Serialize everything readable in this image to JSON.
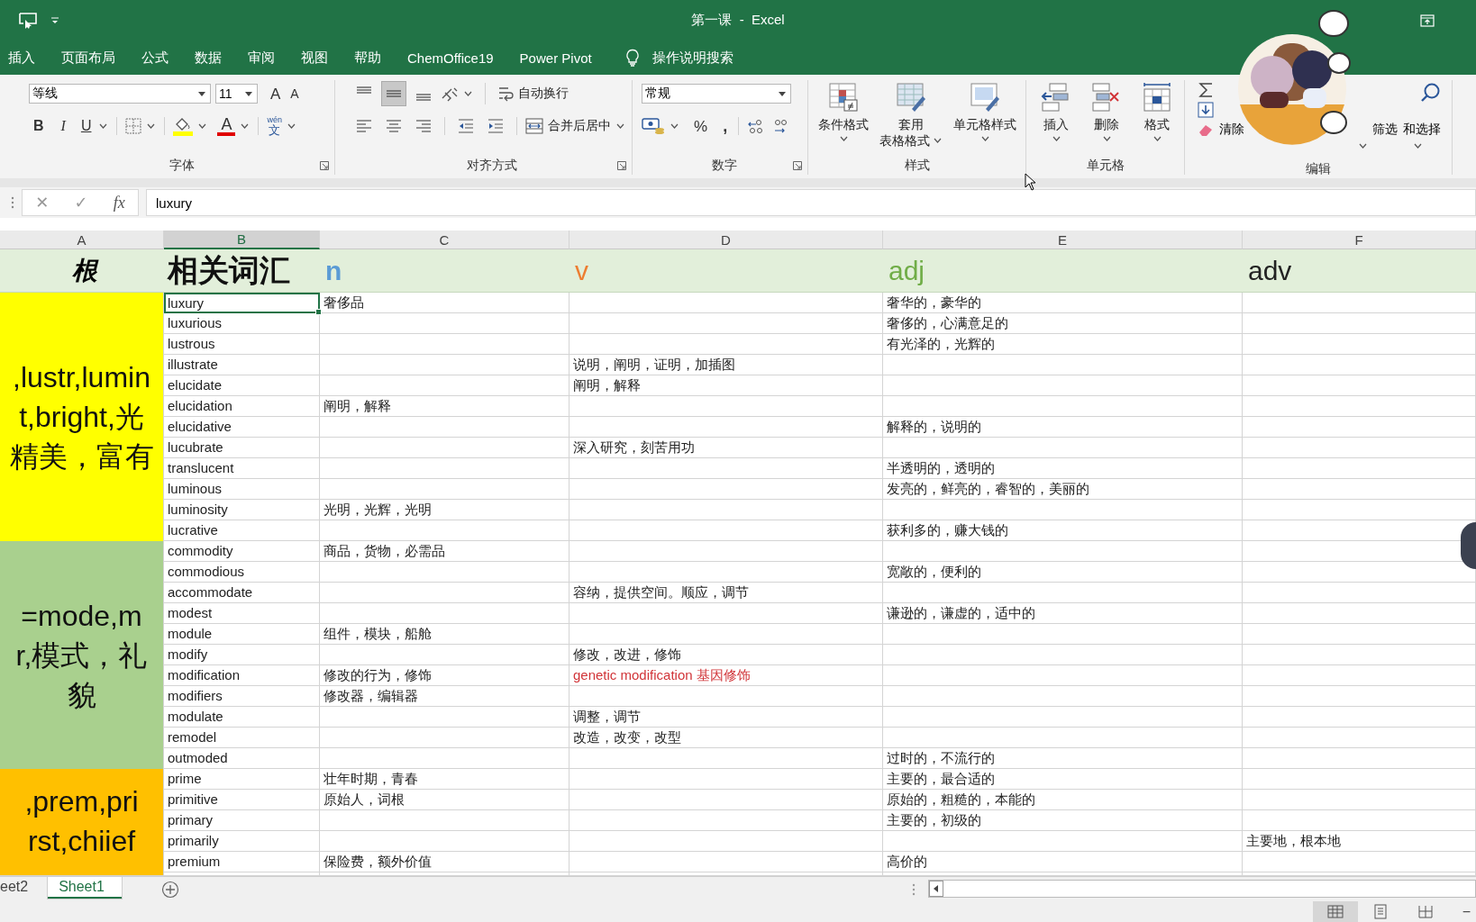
{
  "title_bar": {
    "title": "第一课  -  Excel"
  },
  "menu_tabs": [
    {
      "label": "插入"
    },
    {
      "label": "页面布局"
    },
    {
      "label": "公式"
    },
    {
      "label": "数据"
    },
    {
      "label": "审阅"
    },
    {
      "label": "视图"
    },
    {
      "label": "帮助"
    },
    {
      "label": "ChemOffice19"
    },
    {
      "label": "Power Pivot"
    }
  ],
  "tell_me": {
    "label": "操作说明搜索"
  },
  "ribbon": {
    "font": {
      "name": "等线",
      "size": "11",
      "grow": "A",
      "shrink": "A",
      "bold": "B",
      "italic": "I",
      "underline": "U",
      "font_color": "A",
      "phonetic_top": "wén",
      "phonetic": "文",
      "label": "字体"
    },
    "alignment": {
      "aligns": [
        {
          "kind": "top",
          "selected": false
        },
        {
          "kind": "middle",
          "selected": true
        },
        {
          "kind": "bottom",
          "selected": false
        }
      ],
      "wrap": "自动换行",
      "merge": "合并后居中",
      "label": "对齐方式"
    },
    "number": {
      "format": "常规",
      "percent": "%",
      "comma": ",",
      "label": "数字"
    },
    "styles": {
      "buttons": [
        {
          "kind": "conditional",
          "lines": [
            "条件格式"
          ]
        },
        {
          "kind": "table",
          "lines": [
            "套用",
            "表格格式"
          ]
        },
        {
          "kind": "cell",
          "lines": [
            "单元格样式"
          ]
        }
      ],
      "label": "样式"
    },
    "cells": {
      "buttons": [
        {
          "kind": "insert",
          "label": "插入"
        },
        {
          "kind": "delete",
          "label": "删除"
        },
        {
          "kind": "format",
          "label": "格式"
        }
      ],
      "label": "单元格"
    },
    "editing": {
      "clear": "清除",
      "filter": "筛选",
      "find": "和选择",
      "label": "编辑"
    }
  },
  "formula_bar": {
    "cancel": "✕",
    "enter": "✓",
    "fx": "fx",
    "value": "luxury"
  },
  "sheet": {
    "columns": [
      {
        "letter": "A",
        "selected": false
      },
      {
        "letter": "B",
        "selected": true
      },
      {
        "letter": "C",
        "selected": false
      },
      {
        "letter": "D",
        "selected": false
      },
      {
        "letter": "E",
        "selected": false
      },
      {
        "letter": "F",
        "selected": false
      }
    ],
    "header_row": [
      {
        "text": "根",
        "color": "#000000"
      },
      {
        "text": "相关词汇",
        "color": "#111111"
      },
      {
        "text": "n",
        "color": "#5b9bd5"
      },
      {
        "text": "v",
        "color": "#ed7d31"
      },
      {
        "text": "adj",
        "color": "#70ad47"
      },
      {
        "text": "adv",
        "color": "#222222"
      }
    ],
    "groups": [
      {
        "color": "#ffff00",
        "lines": [
          ",lustr,lumin",
          "t,bright,光",
          "精美，富有"
        ],
        "rows": [
          {
            "B": "luxury",
            "C": "奢侈品",
            "E": "奢华的，豪华的",
            "selected": true
          },
          {
            "B": "luxurious",
            "E": "奢侈的，心满意足的",
            "selected": false
          },
          {
            "B": "lustrous",
            "E": "有光泽的，光辉的",
            "selected": false
          },
          {
            "B": "illustrate",
            "D": "说明，阐明，证明，加插图",
            "selected": false
          },
          {
            "B": "elucidate",
            "D": "阐明，解释",
            "selected": false
          },
          {
            "B": "elucidation",
            "C": "阐明，解释",
            "selected": false
          },
          {
            "B": "elucidative",
            "E": "解释的，说明的",
            "selected": false
          },
          {
            "B": "lucubrate",
            "D": "深入研究，刻苦用功",
            "selected": false
          },
          {
            "B": "translucent",
            "E": "半透明的，透明的",
            "selected": false
          },
          {
            "B": "luminous",
            "E": "发亮的，鲜亮的，睿智的，美丽的",
            "selected": false
          },
          {
            "B": "luminosity",
            "C": "光明，光辉，光明",
            "selected": false
          },
          {
            "B": "lucrative",
            "E": "获利多的，赚大钱的",
            "selected": false
          }
        ]
      },
      {
        "color": "#a9d08e",
        "lines": [
          "=mode,m",
          "r,模式，礼",
          "貌"
        ],
        "rows": [
          {
            "B": "commodity",
            "C": "商品，货物，必需品",
            "selected": false
          },
          {
            "B": "commodious",
            "E": "宽敞的，便利的",
            "selected": false
          },
          {
            "B": "accommodate",
            "D": "容纳，提供空间。顺应，调节",
            "selected": false
          },
          {
            "B": "modest",
            "E": "谦逊的，谦虚的，适中的",
            "selected": false
          },
          {
            "B": "module",
            "C": "组件，模块，船舱",
            "selected": false
          },
          {
            "B": "modify",
            "D": "修改，改进，修饰",
            "selected": false
          },
          {
            "B": "modification",
            "C": "修改的行为，修饰",
            "D": {
              "text": "genetic modification 基因修饰",
              "color": "#d13438"
            },
            "selected": false
          },
          {
            "B": "modifiers",
            "C": "修改器，编辑器",
            "selected": false
          },
          {
            "B": "modulate",
            "D": "调整，调节",
            "selected": false
          },
          {
            "B": "remodel",
            "D": "改造，改变，改型",
            "selected": false
          },
          {
            "B": "outmoded",
            "E": "过时的，不流行的",
            "selected": false
          }
        ]
      },
      {
        "color": "#ffc000",
        "lines": [
          ",prem,pri",
          "rst,chiief"
        ],
        "rows": [
          {
            "B": "prime",
            "C": "壮年时期，青春",
            "E": "主要的，最合适的",
            "selected": false
          },
          {
            "B": "primitive",
            "C": "原始人，词根",
            "E": "原始的，粗糙的，本能的",
            "selected": false
          },
          {
            "B": "primary",
            "E": "主要的，初级的",
            "selected": false
          },
          {
            "B": "primarily",
            "F": "主要地，根本地",
            "selected": false
          },
          {
            "B": "premium",
            "C": "保险费，额外价值",
            "E": "高价的",
            "selected": false
          }
        ]
      }
    ]
  },
  "sheet_tabs": [
    {
      "label": "eet2",
      "selected": false
    },
    {
      "label": "Sheet1",
      "selected": true
    }
  ],
  "status_bar": {
    "views": [
      {
        "kind": "normal",
        "selected": true
      },
      {
        "kind": "page-layout",
        "selected": false
      },
      {
        "kind": "page-break",
        "selected": false
      }
    ],
    "zoom_out": "−"
  }
}
